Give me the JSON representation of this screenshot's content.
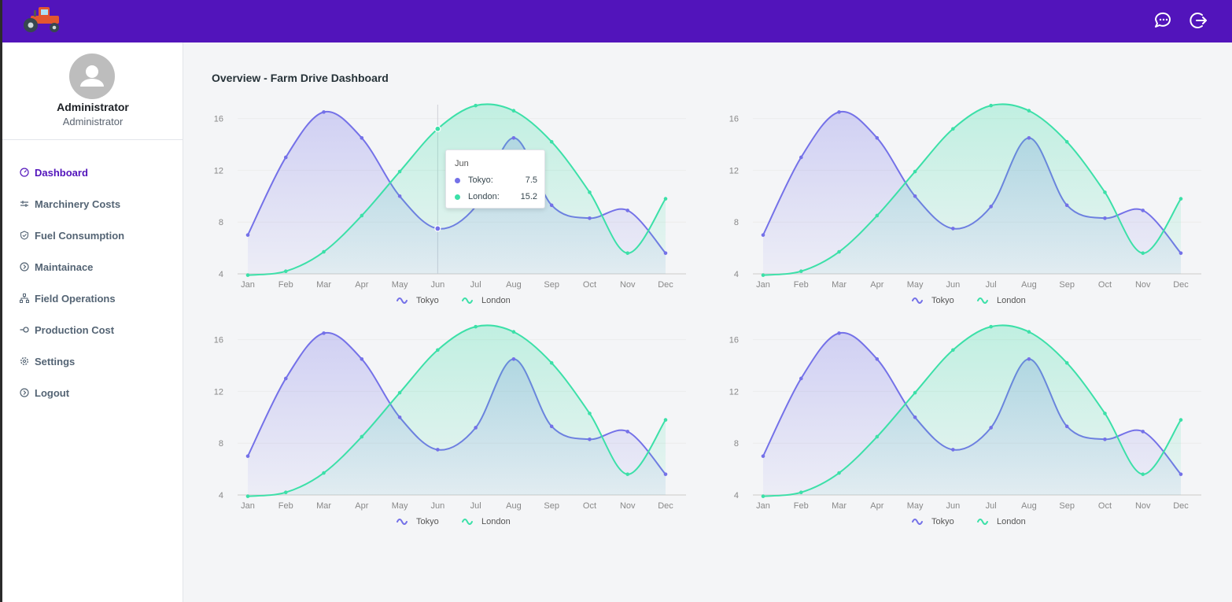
{
  "topbar": {
    "icons": [
      "tractor-logo",
      "chat-icon",
      "logout-icon"
    ]
  },
  "user": {
    "name": "Administrator",
    "role": "Administrator"
  },
  "nav": {
    "items": [
      {
        "label": "Dashboard",
        "icon": "dashboard-icon",
        "active": true
      },
      {
        "label": "Marchinery Costs",
        "icon": "machinery-icon",
        "active": false
      },
      {
        "label": "Fuel Consumption",
        "icon": "fuel-icon",
        "active": false
      },
      {
        "label": "Maintainace",
        "icon": "maintenance-icon",
        "active": false
      },
      {
        "label": "Field Operations",
        "icon": "field-operations-icon",
        "active": false
      },
      {
        "label": "Production Cost",
        "icon": "production-cost-icon",
        "active": false
      },
      {
        "label": "Settings",
        "icon": "settings-icon",
        "active": false
      },
      {
        "label": "Logout",
        "icon": "logout-icon",
        "active": false
      }
    ]
  },
  "page": {
    "title": "Overview - Farm Drive Dashboard"
  },
  "colors": {
    "brand": "#5214bb",
    "tokyo": "#7471e8",
    "london": "#3ce0a8",
    "active_nav": "#5214bb"
  },
  "tooltip": {
    "title": "Jun",
    "rows": [
      {
        "label": "Tokyo:",
        "value": "7.5"
      },
      {
        "label": "London:",
        "value": "15.2"
      }
    ]
  },
  "chart_data": [
    {
      "type": "area",
      "categories": [
        "Jan",
        "Feb",
        "Mar",
        "Apr",
        "May",
        "Jun",
        "Jul",
        "Aug",
        "Sep",
        "Oct",
        "Nov",
        "Dec"
      ],
      "yticks": [
        "4",
        "8",
        "12",
        "16"
      ],
      "ylim": [
        4,
        17
      ],
      "series": [
        {
          "name": "Tokyo",
          "values": [
            7.0,
            13.0,
            16.5,
            14.5,
            10.0,
            7.5,
            9.2,
            14.5,
            9.3,
            8.3,
            8.9,
            5.6
          ]
        },
        {
          "name": "London",
          "values": [
            3.9,
            4.2,
            5.7,
            8.5,
            11.9,
            15.2,
            17.0,
            16.6,
            14.2,
            10.3,
            5.6,
            9.8
          ]
        }
      ],
      "legend": "bottom-center",
      "grid": true
    },
    {
      "type": "area",
      "categories": [
        "Jan",
        "Feb",
        "Mar",
        "Apr",
        "May",
        "Jun",
        "Jul",
        "Aug",
        "Sep",
        "Oct",
        "Nov",
        "Dec"
      ],
      "yticks": [
        "4",
        "8",
        "12",
        "16"
      ],
      "ylim": [
        4,
        17
      ],
      "series": [
        {
          "name": "Tokyo",
          "values": [
            7.0,
            13.0,
            16.5,
            14.5,
            10.0,
            7.5,
            9.2,
            14.5,
            9.3,
            8.3,
            8.9,
            5.6
          ]
        },
        {
          "name": "London",
          "values": [
            3.9,
            4.2,
            5.7,
            8.5,
            11.9,
            15.2,
            17.0,
            16.6,
            14.2,
            10.3,
            5.6,
            9.8
          ]
        }
      ],
      "legend": "bottom-center",
      "grid": true
    },
    {
      "type": "area",
      "categories": [
        "Jan",
        "Feb",
        "Mar",
        "Apr",
        "May",
        "Jun",
        "Jul",
        "Aug",
        "Sep",
        "Oct",
        "Nov",
        "Dec"
      ],
      "yticks": [
        "4",
        "8",
        "12",
        "16"
      ],
      "ylim": [
        4,
        17
      ],
      "series": [
        {
          "name": "Tokyo",
          "values": [
            7.0,
            13.0,
            16.5,
            14.5,
            10.0,
            7.5,
            9.2,
            14.5,
            9.3,
            8.3,
            8.9,
            5.6
          ]
        },
        {
          "name": "London",
          "values": [
            3.9,
            4.2,
            5.7,
            8.5,
            11.9,
            15.2,
            17.0,
            16.6,
            14.2,
            10.3,
            5.6,
            9.8
          ]
        }
      ],
      "legend": "bottom-center",
      "grid": true
    },
    {
      "type": "area",
      "categories": [
        "Jan",
        "Feb",
        "Mar",
        "Apr",
        "May",
        "Jun",
        "Jul",
        "Aug",
        "Sep",
        "Oct",
        "Nov",
        "Dec"
      ],
      "yticks": [
        "4",
        "8",
        "12",
        "16"
      ],
      "ylim": [
        4,
        17
      ],
      "series": [
        {
          "name": "Tokyo",
          "values": [
            7.0,
            13.0,
            16.5,
            14.5,
            10.0,
            7.5,
            9.2,
            14.5,
            9.3,
            8.3,
            8.9,
            5.6
          ]
        },
        {
          "name": "London",
          "values": [
            3.9,
            4.2,
            5.7,
            8.5,
            11.9,
            15.2,
            17.0,
            16.6,
            14.2,
            10.3,
            5.6,
            9.8
          ]
        }
      ],
      "legend": "bottom-center",
      "grid": true
    }
  ]
}
